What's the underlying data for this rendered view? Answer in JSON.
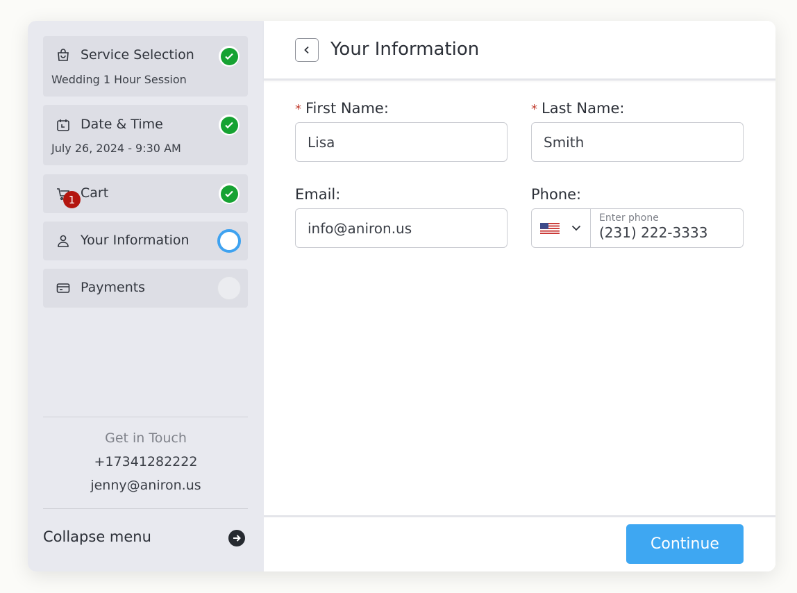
{
  "sidebar": {
    "steps": [
      {
        "title": "Service Selection",
        "subtitle": "Wedding 1 Hour Session",
        "icon": "shopping-bag-icon",
        "status": "done"
      },
      {
        "title": "Date & Time",
        "subtitle": "July 26, 2024 - 9:30 AM",
        "icon": "calendar-icon",
        "status": "done"
      },
      {
        "title": "Cart",
        "subtitle": "",
        "icon": "cart-icon",
        "status": "done",
        "badge": "1"
      },
      {
        "title": "Your Information",
        "subtitle": "",
        "icon": "user-icon",
        "status": "active"
      },
      {
        "title": "Payments",
        "subtitle": "",
        "icon": "card-icon",
        "status": "pending"
      }
    ],
    "contact": {
      "heading": "Get in Touch",
      "phone": "+17341282222",
      "email": "jenny@aniron.us"
    },
    "collapse_label": "Collapse menu"
  },
  "main": {
    "title": "Your Information",
    "form": {
      "first_name": {
        "label": "First Name:",
        "value": "Lisa",
        "required": true
      },
      "last_name": {
        "label": "Last Name:",
        "value": "Smith",
        "required": true
      },
      "email": {
        "label": "Email:",
        "value": "info@aniron.us"
      },
      "phone": {
        "label": "Phone:",
        "placeholder": "Enter phone",
        "value": "(231) 222-3333",
        "country": "US"
      }
    },
    "required_mark": "*",
    "continue_label": "Continue"
  },
  "colors": {
    "accent": "#3ea7f2",
    "done": "#16a232",
    "badge": "#b3160f",
    "sidebar_bg": "#e8e9ef"
  }
}
